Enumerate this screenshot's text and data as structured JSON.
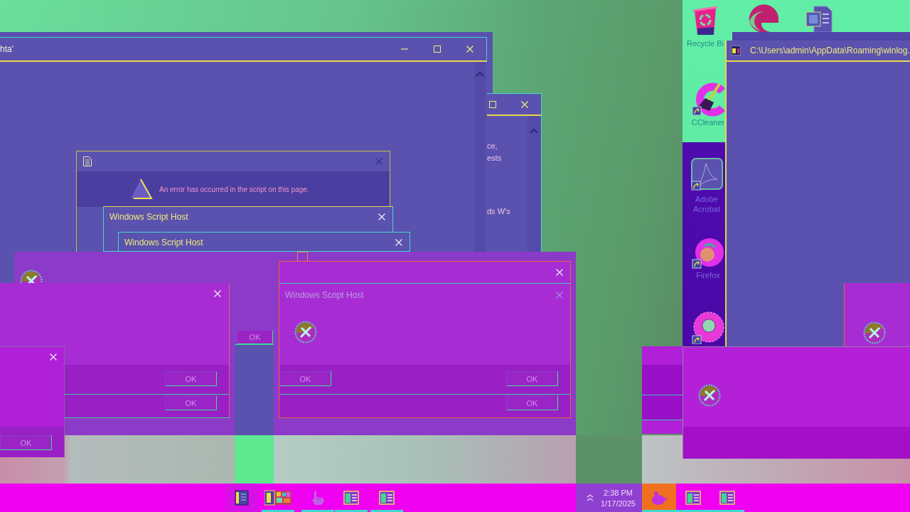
{
  "hta_window": {
    "title": "hta'"
  },
  "back_window": {
    "text_fragments": [
      "ce,",
      "ests",
      "ds W's"
    ]
  },
  "error_dialog": {
    "message": "An error has occurred in the script on this page."
  },
  "script_host_dialogs": [
    {
      "title": "Windows Script Host"
    },
    {
      "title": "Windows Script Host"
    }
  ],
  "background_dialog": {
    "button": "OK"
  },
  "message_boxes": [
    {
      "kind": "blank",
      "button_rows": [
        [
          "OK"
        ],
        [
          "OK"
        ]
      ]
    },
    {
      "kind": "blank",
      "button_rows": [
        [
          "OK"
        ]
      ]
    },
    {
      "kind": "script-host",
      "title": "Windows Script Host",
      "button_rows": [
        [
          "OK",
          "OK"
        ],
        [
          "OK"
        ]
      ]
    },
    {
      "kind": "icon-only"
    },
    {
      "kind": "icon-only"
    }
  ],
  "desktop_icons": [
    {
      "kind": "recycle-bin",
      "label": "Recycle Bi"
    },
    {
      "kind": "edge"
    },
    {
      "kind": "word"
    },
    {
      "kind": "ccleaner",
      "label": "CCleaner"
    },
    {
      "kind": "acrobat",
      "label": "Adobe Acrobat"
    },
    {
      "kind": "firefox",
      "label": "Firefox"
    },
    {
      "kind": "disc"
    }
  ],
  "path_window": {
    "title": "C:\\Users\\admin\\AppData\\Roaming\\winlog."
  },
  "taskbar": {
    "apps": [
      {
        "kind": "document",
        "running": false
      },
      {
        "kind": "mosaic",
        "running": true
      },
      {
        "kind": "pointer",
        "running": true
      },
      {
        "kind": "window",
        "running": true
      },
      {
        "kind": "window",
        "running": true
      }
    ],
    "clock": {
      "time": "2:38 PM",
      "date": "1/17/2025"
    },
    "apps_after_clock": [
      {
        "kind": "blob",
        "active": true,
        "running": true
      },
      {
        "kind": "window",
        "active": false,
        "running": true
      },
      {
        "kind": "window",
        "active": false,
        "running": true
      }
    ]
  }
}
